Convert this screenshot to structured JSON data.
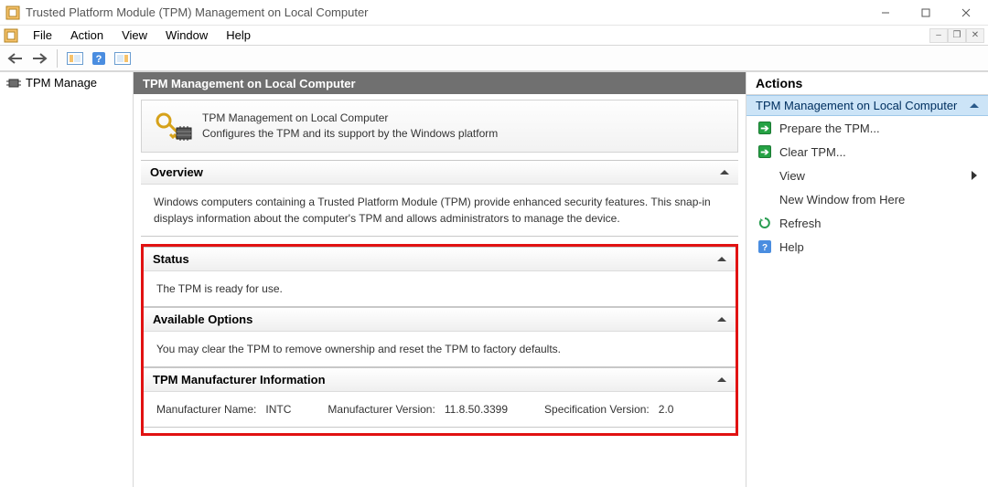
{
  "window": {
    "title": "Trusted Platform Module (TPM) Management on Local Computer"
  },
  "menu": {
    "file": "File",
    "action": "Action",
    "view": "View",
    "window": "Window",
    "help": "Help"
  },
  "tree": {
    "root": "TPM Manage"
  },
  "center": {
    "header": "TPM Management on Local Computer",
    "intro_title": "TPM Management on Local Computer",
    "intro_desc": "Configures the TPM and its support by the Windows platform",
    "overview": {
      "title": "Overview",
      "body": "Windows computers containing a Trusted Platform Module (TPM) provide enhanced security features. This snap-in displays information about the computer's TPM and allows administrators to manage the device."
    },
    "status": {
      "title": "Status",
      "body": "The TPM is ready for use."
    },
    "options": {
      "title": "Available Options",
      "body": "You may clear the TPM to remove ownership and reset the TPM to factory defaults."
    },
    "mfr": {
      "title": "TPM Manufacturer Information",
      "name_label": "Manufacturer Name:",
      "name_value": "INTC",
      "ver_label": "Manufacturer Version:",
      "ver_value": "11.8.50.3399",
      "spec_label": "Specification Version:",
      "spec_value": "2.0"
    }
  },
  "actions": {
    "header": "Actions",
    "section": "TPM Management on Local Computer",
    "prepare": "Prepare the TPM...",
    "clear": "Clear TPM...",
    "view": "View",
    "new_window": "New Window from Here",
    "refresh": "Refresh",
    "help": "Help"
  }
}
